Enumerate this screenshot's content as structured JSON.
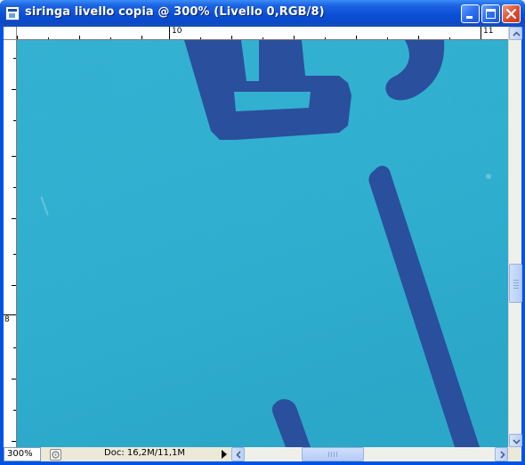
{
  "window": {
    "title": "siringa livello copia @ 300% (Livello 0,RGB/8)",
    "icon": "photoshop-document-icon",
    "controls": [
      "minimize-icon",
      "maximize-icon",
      "close-icon"
    ]
  },
  "rulers": {
    "horizontal_labels": [
      "10",
      "11"
    ],
    "vertical_labels": [
      "8"
    ]
  },
  "statusbar": {
    "zoom": "300%",
    "doc_info": "Doc: 16,2M/11,1M",
    "info_icon": "status-info-icon",
    "menu_arrow_icon": "play-arrow-icon"
  },
  "colors": {
    "canvas_background": "#2fb1d2",
    "marking": "#2a4f9c",
    "titlebar": "#0a4fd7"
  }
}
